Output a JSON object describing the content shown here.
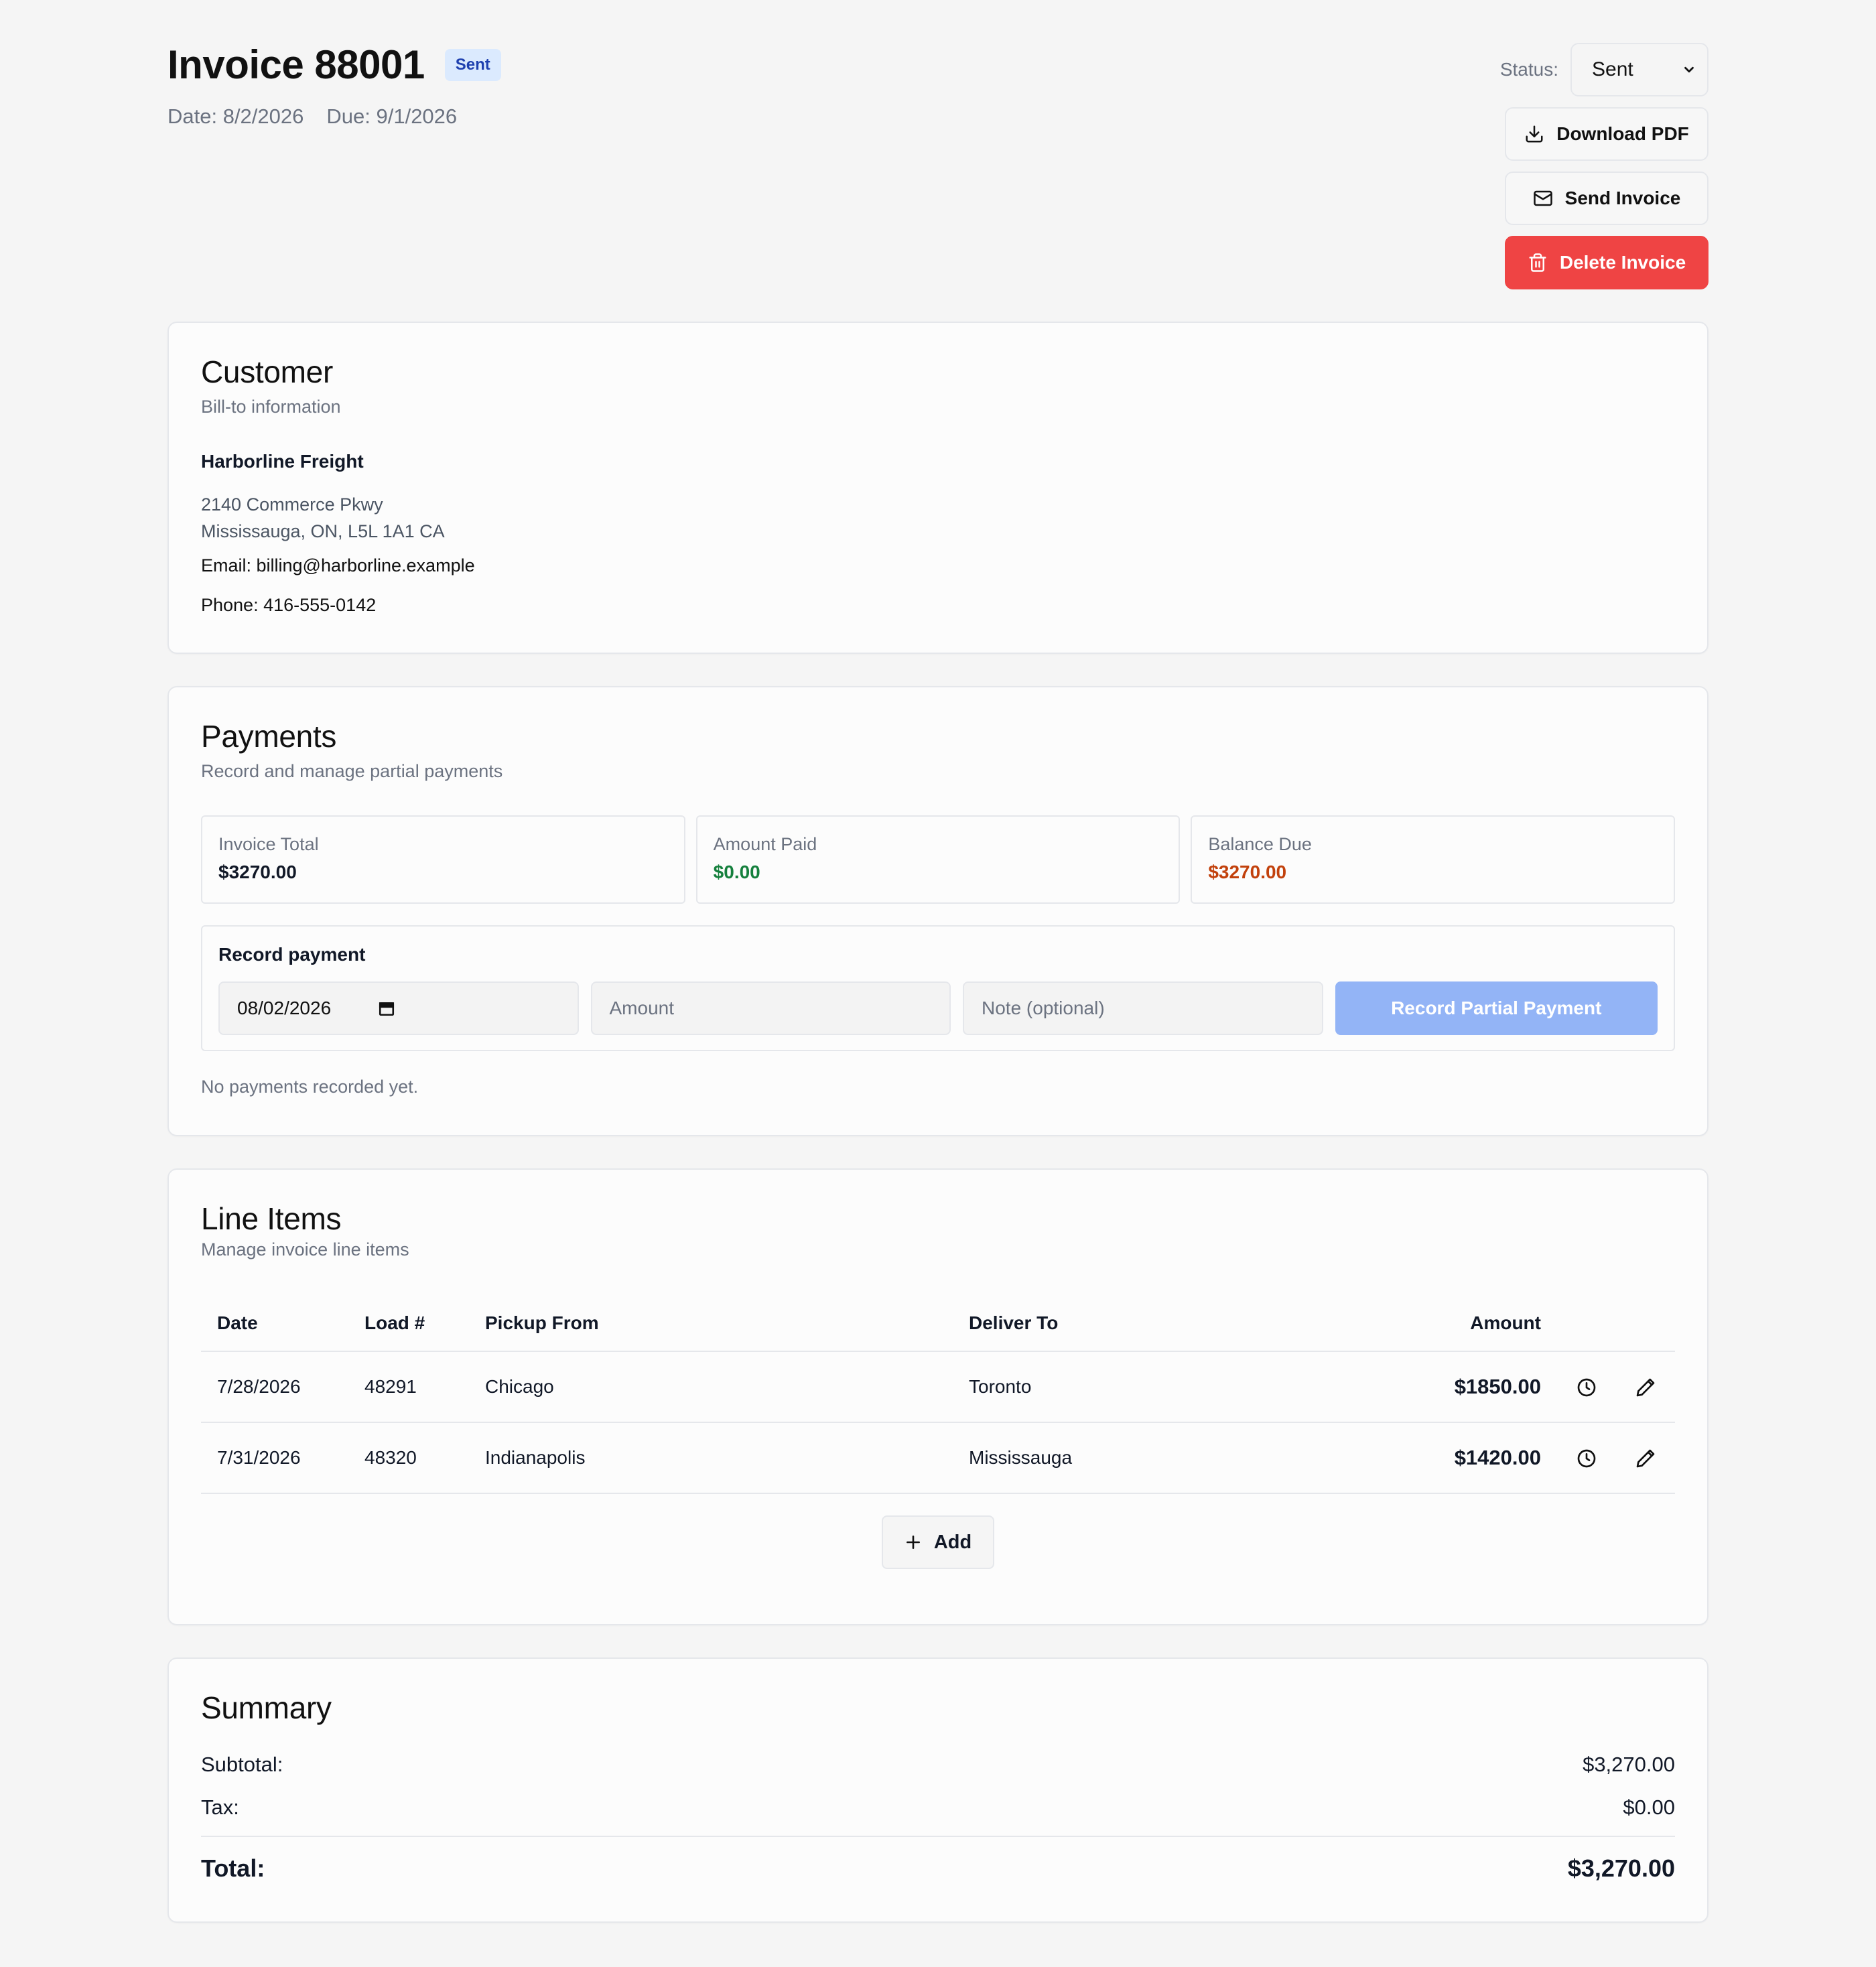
{
  "invoice": {
    "title": "Invoice 88001",
    "badge": "Sent",
    "date": "Date: 8/2/2026",
    "due": "Due: 9/1/2026"
  },
  "actions": {
    "status_label": "Status:",
    "status_value": "Sent",
    "download_label": "Download PDF",
    "send_label": "Send Invoice",
    "delete_label": "Delete Invoice"
  },
  "customer": {
    "title": "Customer",
    "subtitle": "Bill-to information",
    "name": "Harborline Freight",
    "address1": "2140 Commerce Pkwy",
    "address2": "Mississauga, ON, L5L 1A1 CA",
    "email": "Email: billing@harborline.example",
    "phone": "Phone: 416-555-0142"
  },
  "payments": {
    "title": "Payments",
    "subtitle": "Record and manage partial payments",
    "stats": [
      {
        "label": "Invoice Total",
        "value": "$3270.00"
      },
      {
        "label": "Amount Paid",
        "value": "$0.00"
      },
      {
        "label": "Balance Due",
        "value": "$3270.00"
      }
    ],
    "record_title": "Record payment",
    "date_value": "08/02/2026",
    "amount_placeholder": "Amount",
    "note_placeholder": "Note (optional)",
    "record_button": "Record Partial Payment",
    "empty_text": "No payments recorded yet."
  },
  "line_items": {
    "title": "Line Items",
    "subtitle": "Manage invoice line items",
    "columns": [
      "Date",
      "Load #",
      "Pickup From",
      "Deliver To",
      "Amount"
    ],
    "rows": [
      {
        "date": "7/28/2026",
        "load": "48291",
        "pickup": "Chicago",
        "deliver": "Toronto",
        "amount": "$1850.00"
      },
      {
        "date": "7/31/2026",
        "load": "48320",
        "pickup": "Indianapolis",
        "deliver": "Mississauga",
        "amount": "$1420.00"
      }
    ],
    "add_label": "Add"
  },
  "summary": {
    "title": "Summary",
    "subtotal_label": "Subtotal:",
    "subtotal_value": "$3,270.00",
    "tax_label": "Tax:",
    "tax_value": "$0.00",
    "total_label": "Total:",
    "total_value": "$3,270.00"
  },
  "colors": {
    "accent_red": "#ef4444",
    "badge_bg": "#dbeafe",
    "paid_green": "#15803d",
    "balance_orange": "#c2410c",
    "record_button_blue": "#93b4f6"
  },
  "icons": {
    "download": "download-icon",
    "send": "mail-icon",
    "delete": "trash-icon",
    "calendar": "calendar-icon",
    "history": "clock-icon",
    "edit": "pencil-icon",
    "add": "plus-icon"
  }
}
